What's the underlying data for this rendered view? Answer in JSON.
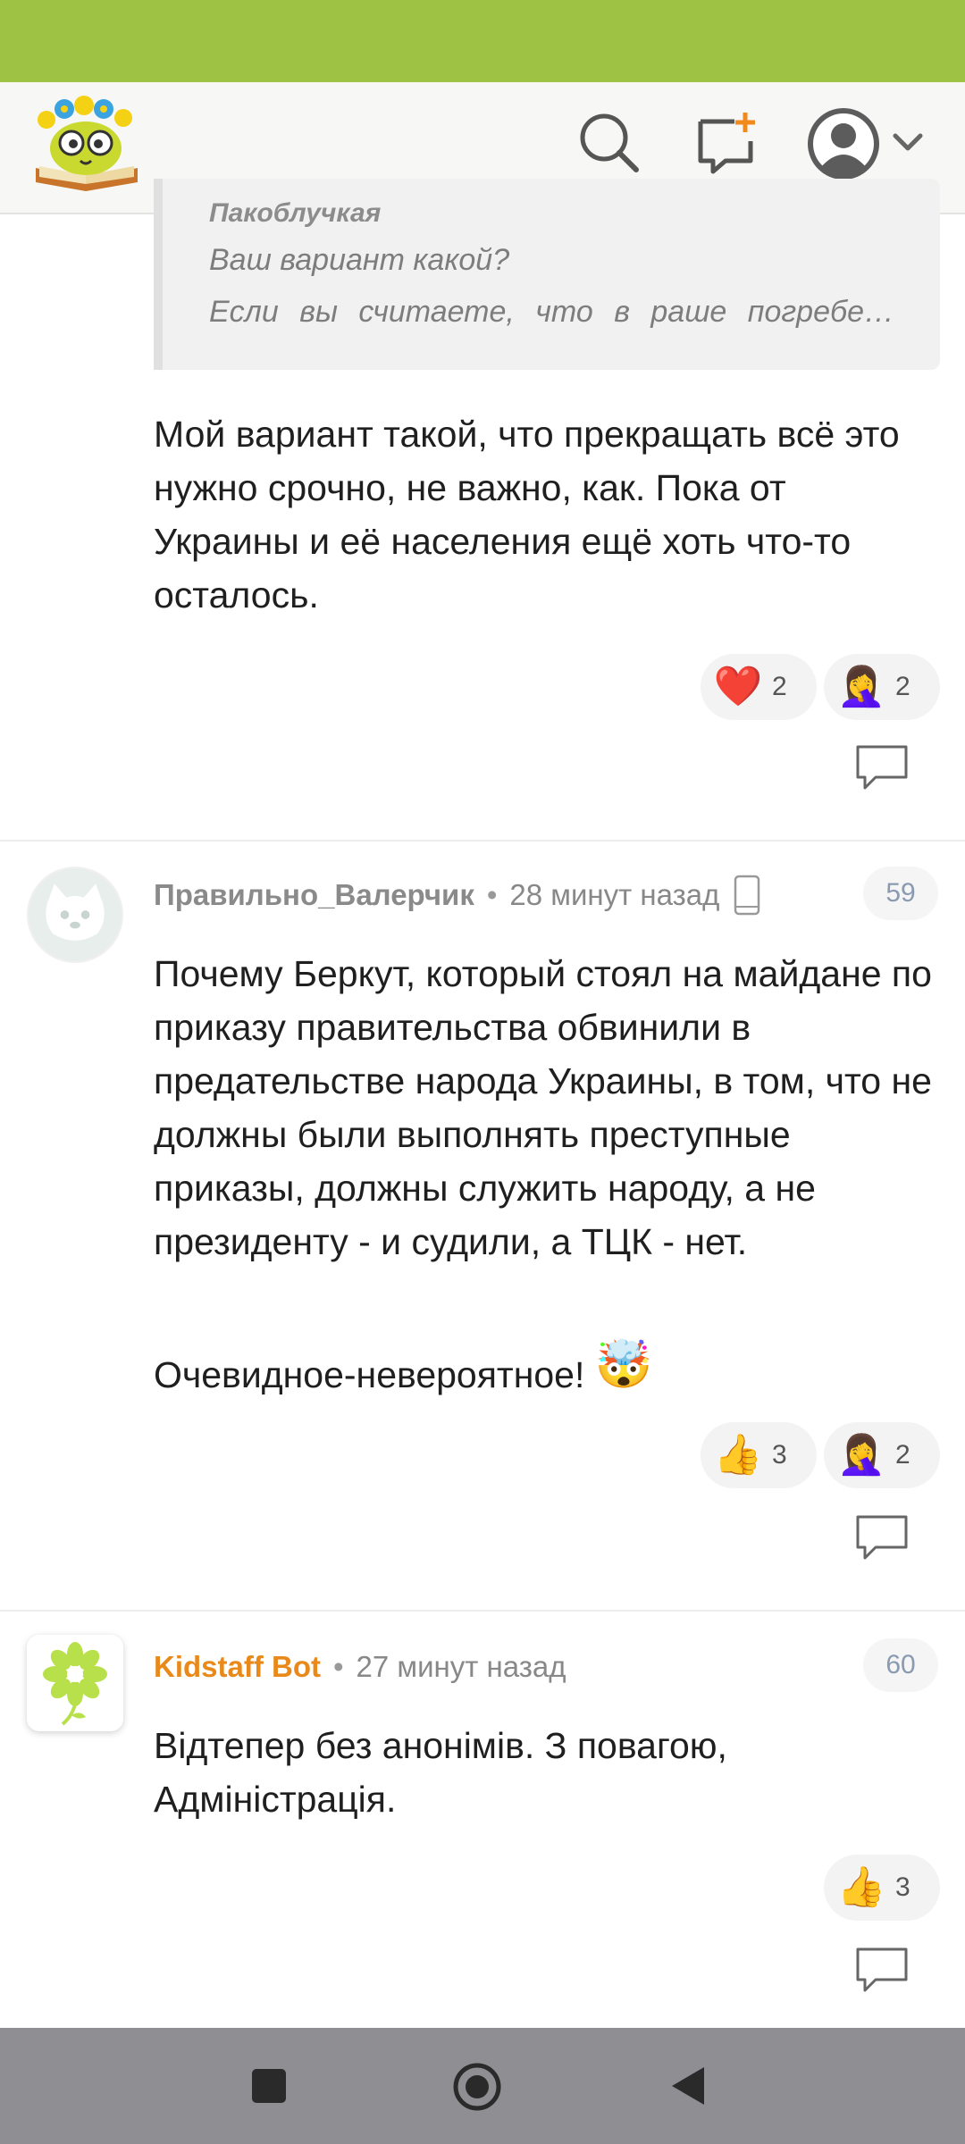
{
  "header": {
    "logo": "kidstaff-logo",
    "search_icon": "search-icon",
    "new_post_icon": "new-message-plus-icon",
    "avatar_icon": "user-avatar-icon"
  },
  "quote": {
    "author": "Пакоблучкая",
    "line1": "Ваш вариант какой?",
    "line2": "Если вы считаете, что в раше погребе…"
  },
  "comments": [
    {
      "text": "Мой вариант такой, что прекращать всё это нужно срочно, не важно, как. Пока от Украины и её населения ещё хоть что-то осталось.",
      "reactions": [
        {
          "emoji": "❤️",
          "count": "2"
        },
        {
          "emoji": "🤦‍♀️",
          "count": "2"
        }
      ]
    },
    {
      "author": "Правильно_Валерчик",
      "time": "28 минут назад",
      "number": "59",
      "paragraph1": "Почему Беркут, который стоял на майдане по приказу правительства обвинили в предательстве народа Украины, в том, что не должны были выполнять преступные приказы, должны служить народу, а не президенту - и судили, а ТЦК - нет.",
      "paragraph2": "Очевидное-невероятное!",
      "paragraph2_emoji": "🤯",
      "reactions": [
        {
          "emoji": "👍",
          "count": "3"
        },
        {
          "emoji": "🤦‍♀️",
          "count": "2"
        }
      ]
    },
    {
      "author": "Kidstaff Bot",
      "time": "27 минут назад",
      "number": "60",
      "text": "Відтепер без анонімів. З повагою, Адміністрація.",
      "reactions": [
        {
          "emoji": "👍",
          "count": "3"
        }
      ]
    }
  ],
  "colors": {
    "status_bar": "#9dc244",
    "bot_author": "#e8891a",
    "nav_bar": "#8e8e93"
  },
  "nav": {
    "recents_icon": "square-icon",
    "home_icon": "circle-home-icon",
    "back_icon": "triangle-back-icon"
  }
}
